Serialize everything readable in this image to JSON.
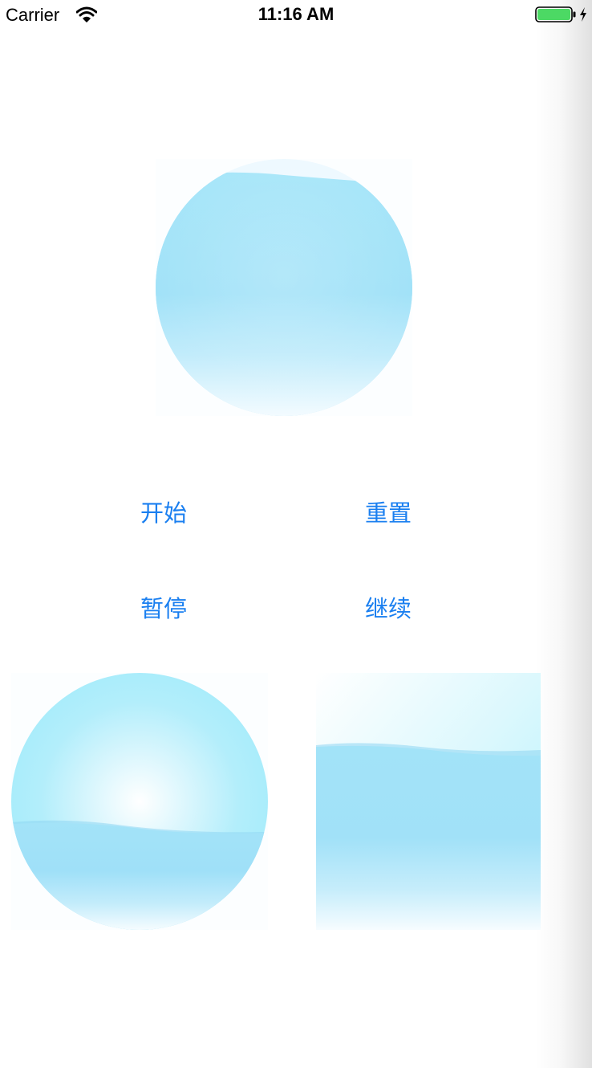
{
  "status_bar": {
    "carrier": "Carrier",
    "time": "11:16 AM",
    "icons": [
      "wifi-icon",
      "battery-icon",
      "charging-icon"
    ],
    "battery_color": "#4cd964"
  },
  "buttons": {
    "start": "开始",
    "reset": "重置",
    "pause": "暂停",
    "resume": "继续"
  },
  "colors": {
    "button_text": "#1a7ff0",
    "wave": "#9fe0f8",
    "wave_light": "#e6f8ff"
  }
}
